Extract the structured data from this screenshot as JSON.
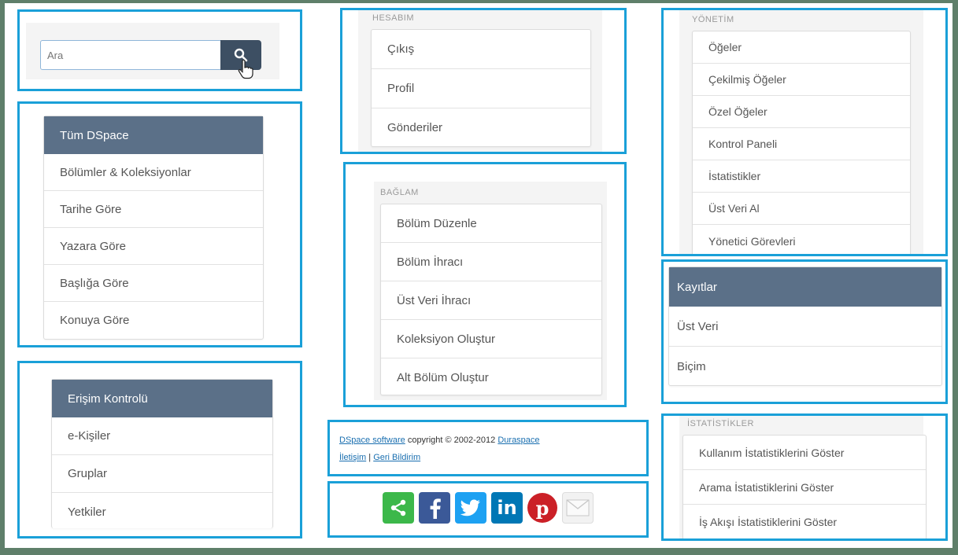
{
  "search": {
    "placeholder": "Ara"
  },
  "browse": {
    "header": "Tüm DSpace",
    "items": [
      "Bölümler & Koleksiyonlar",
      "Tarihe Göre",
      "Yazara Göre",
      "Başlığa Göre",
      "Konuya Göre"
    ]
  },
  "access": {
    "header": "Erişim Kontrolü",
    "items": [
      "e-Kişiler",
      "Gruplar",
      "Yetkiler"
    ]
  },
  "account": {
    "label": "HESABIM",
    "items": [
      "Çıkış",
      "Profil",
      "Gönderiler"
    ]
  },
  "context": {
    "label": "BAĞLAM",
    "items": [
      "Bölüm Düzenle",
      "Bölüm İhracı",
      "Üst Veri İhracı",
      "Koleksiyon Oluştur",
      "Alt Bölüm Oluştur"
    ]
  },
  "footer": {
    "software_link": "DSpace software",
    "copyright": " copyright © 2002-2012 ",
    "duraspace_link": "Duraspace",
    "contact_link": "İletişim",
    "separator": " | ",
    "feedback_link": "Geri Bildirim"
  },
  "social": {
    "icons": [
      "share-icon",
      "facebook-icon",
      "twitter-icon",
      "linkedin-icon",
      "pinterest-icon",
      "email-icon"
    ],
    "colors": {
      "share": "#3cb84a",
      "facebook": "#3b5998",
      "twitter": "#1da1f2",
      "linkedin": "#0077b5",
      "pinterest": "#cb2027",
      "email": "#e6e6e6"
    }
  },
  "admin": {
    "label": "YÖNETİM",
    "items": [
      "Öğeler",
      "Çekilmiş Öğeler",
      "Özel Öğeler",
      "Kontrol Paneli",
      "İstatistikler",
      "Üst Veri Al",
      "Yönetici Görevleri"
    ]
  },
  "registry": {
    "header": "Kayıtlar",
    "items": [
      "Üst Veri",
      "Biçim"
    ]
  },
  "statistics": {
    "label": "İSTATİSTİKLER",
    "items": [
      "Kullanım İstatistiklerini Göster",
      "Arama İstatistiklerini Göster",
      "İş Akışı İstatistiklerini Göster"
    ]
  },
  "colors": {
    "highlight_border": "#1aa0d8",
    "panel_header": "#5b7088",
    "search_button": "#3d4f63"
  }
}
